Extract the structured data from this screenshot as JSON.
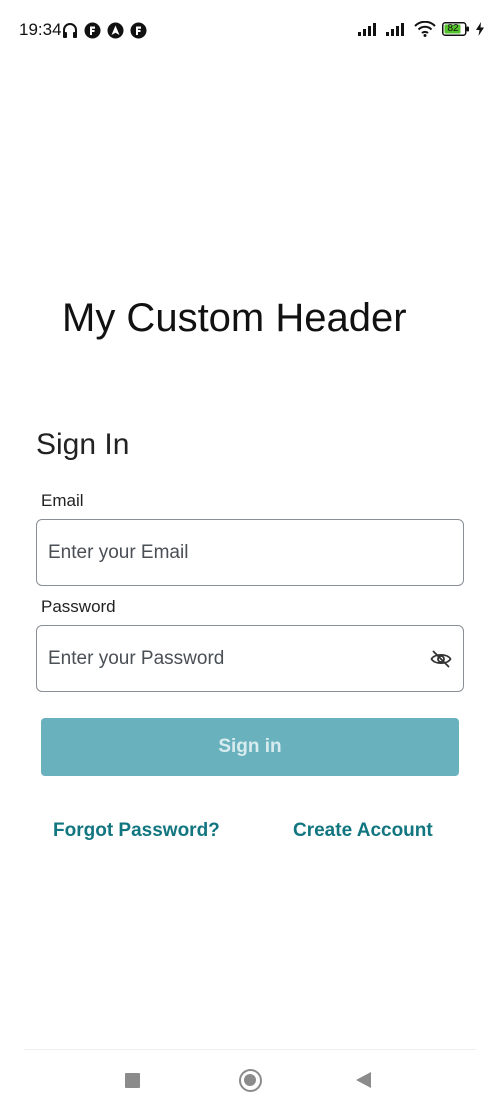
{
  "status_bar": {
    "time": "19:34",
    "battery_level": "82",
    "left_icons": [
      "headphones-icon",
      "app-notification-icon",
      "navigation-icon",
      "app-notification-icon"
    ],
    "right_icons": [
      "signal-icon",
      "signal-icon",
      "wifi-icon",
      "battery-icon",
      "charging-icon"
    ]
  },
  "header": {
    "title": "My Custom Header"
  },
  "form": {
    "heading": "Sign In",
    "email": {
      "label": "Email",
      "placeholder": "Enter your Email",
      "value": ""
    },
    "password": {
      "label": "Password",
      "placeholder": "Enter your Password",
      "value": "",
      "toggle_icon": "eye-off-icon"
    },
    "submit_label": "Sign in"
  },
  "links": {
    "forgot_password": "Forgot Password?",
    "create_account": "Create Account"
  },
  "colors": {
    "accent": "#127680",
    "button_disabled": "#69b1bd",
    "button_text": "#d8ecef"
  },
  "nav_bar": {
    "buttons": [
      "recents-icon",
      "home-icon",
      "back-icon"
    ]
  }
}
